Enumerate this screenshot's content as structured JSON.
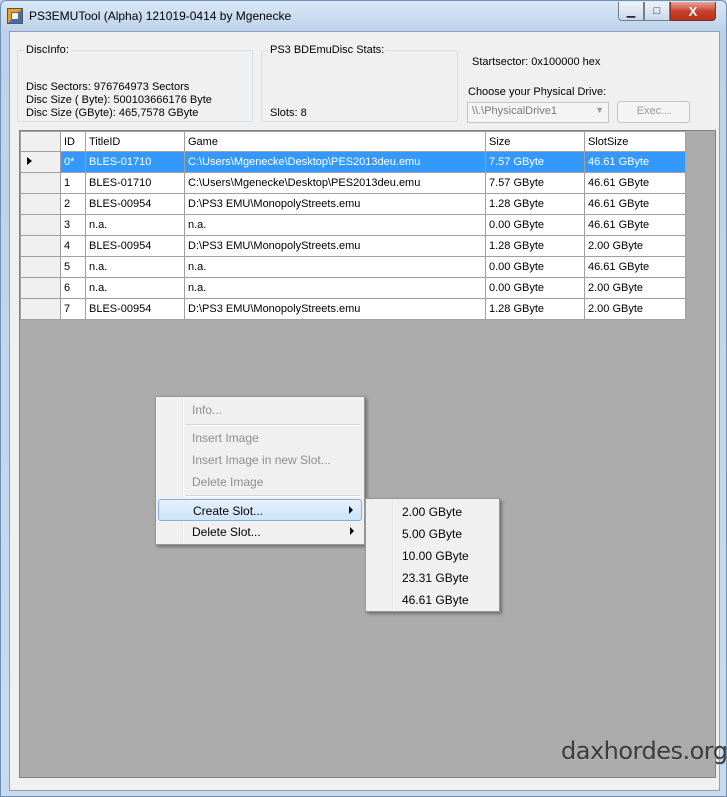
{
  "window": {
    "title": "PS3EMUTool (Alpha) 121019-0414 by Mgenecke",
    "controls": {
      "minimize": "▁",
      "maximize": "□",
      "close": "X"
    }
  },
  "disc_info": {
    "title": "DiscInfo:",
    "sectors": "Disc Sectors: 976764973 Sectors",
    "size_byte": "Disc Size ( Byte): 500103666176 Byte",
    "size_gbyte": "Disc Size (GByte): 465,7578 GByte"
  },
  "emu_stats": {
    "title": "PS3 BDEmuDisc Stats:",
    "slots": "Slots: 8"
  },
  "drive": {
    "startsector": "Startsector: 0x100000 hex",
    "choose_label": "Choose your Physical Drive:",
    "selected": "\\\\.\\PhysicalDrive1",
    "exec_label": "Exec..."
  },
  "table": {
    "columns": [
      "ID",
      "TitleID",
      "Game",
      "Size",
      "SlotSize"
    ],
    "rows": [
      {
        "id": "0*",
        "title_id": "BLES-01710",
        "game": "C:\\Users\\Mgenecke\\Desktop\\PES2013deu.emu",
        "size": "7.57 GByte",
        "slot_size": "46.61 GByte"
      },
      {
        "id": "1",
        "title_id": "BLES-01710",
        "game": "C:\\Users\\Mgenecke\\Desktop\\PES2013deu.emu",
        "size": "7.57 GByte",
        "slot_size": "46.61 GByte"
      },
      {
        "id": "2",
        "title_id": "BLES-00954",
        "game": "D:\\PS3 EMU\\MonopolyStreets.emu",
        "size": "1.28 GByte",
        "slot_size": "46.61 GByte"
      },
      {
        "id": "3",
        "title_id": "n.a.",
        "game": "n.a.",
        "size": "0.00 GByte",
        "slot_size": "46.61 GByte"
      },
      {
        "id": "4",
        "title_id": "BLES-00954",
        "game": "D:\\PS3 EMU\\MonopolyStreets.emu",
        "size": "1.28 GByte",
        "slot_size": "2.00 GByte"
      },
      {
        "id": "5",
        "title_id": "n.a.",
        "game": "n.a.",
        "size": "0.00 GByte",
        "slot_size": "46.61 GByte"
      },
      {
        "id": "6",
        "title_id": "n.a.",
        "game": "n.a.",
        "size": "0.00 GByte",
        "slot_size": "2.00 GByte"
      },
      {
        "id": "7",
        "title_id": "BLES-00954",
        "game": "D:\\PS3 EMU\\MonopolyStreets.emu",
        "size": "1.28 GByte",
        "slot_size": "2.00 GByte"
      }
    ]
  },
  "context_menu": {
    "info": "Info...",
    "insert_image": "Insert Image",
    "insert_image_new_slot": "Insert Image in new Slot...",
    "delete_image": "Delete Image",
    "create_slot": "Create Slot...",
    "delete_slot": "Delete Slot..."
  },
  "submenu": {
    "items": [
      "2.00 GByte",
      "5.00 GByte",
      "10.00 GByte",
      "23.31 GByte",
      "46.61 GByte"
    ]
  },
  "watermark": "daxhordes.org"
}
